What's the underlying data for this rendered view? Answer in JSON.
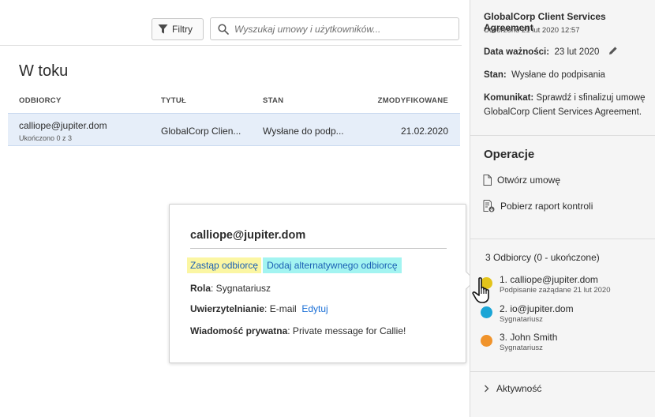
{
  "toolbar": {
    "filter_label": "Filtry",
    "search_placeholder": "Wyszukaj umowy i użytkowników..."
  },
  "main": {
    "section_title": "W toku",
    "columns": {
      "recipient": "ODBIORCY",
      "title": "TYTUŁ",
      "state": "STAN",
      "modified": "ZMODYFIKOWANE"
    },
    "rows": [
      {
        "recipient": "calliope@jupiter.dom",
        "progress": "Ukończono 0 z 3",
        "title": "GlobalCorp Clien...",
        "state": "Wysłane do podp...",
        "modified": "21.02.2020"
      }
    ]
  },
  "popover": {
    "title": "calliope@jupiter.dom",
    "replace_label": "Zastąp odbiorcę",
    "alt_label": "Dodaj alternatywnego odbiorcę",
    "role_label": "Rola",
    "role_value": ": Sygnatariusz",
    "auth_label": "Uwierzytelnianie",
    "auth_value": ": E-mail",
    "edit_label": "Edytuj",
    "msg_label": "Wiadomość prywatna",
    "msg_value": ": Private message for Callie!",
    "highlight_yellow": "#fbf6a3",
    "highlight_cyan": "#a3f4f1"
  },
  "details": {
    "title": "GlobalCorp Client Services Agreement",
    "created": "Utworzono 21 lut 2020 12:57",
    "expiry_label": "Data ważności:",
    "expiry_value": "23 lut 2020",
    "state_label": "Stan:",
    "state_value": "Wysłane do podpisania",
    "message_label": "Komunikat:",
    "message_value": "Sprawdź i sfinalizuj umowę GlobalCorp Client Services Agreement.",
    "operations_title": "Operacje",
    "op_open": "Otwórz umowę",
    "op_report": "Pobierz raport kontroli",
    "recipients_head": "3 Odbiorcy (0 - ukończone)",
    "recipients": [
      {
        "name": "1. calliope@jupiter.dom",
        "sub": "Podpisanie zażądane 21 lut 2020",
        "color": "#e3c31a"
      },
      {
        "name": "2. io@jupiter.dom",
        "sub": "Sygnatariusz",
        "color": "#1aa5d6"
      },
      {
        "name": "3. John Smith",
        "sub": "Sygnatariusz",
        "color": "#f0932b"
      }
    ],
    "activity_label": "Aktywność"
  }
}
